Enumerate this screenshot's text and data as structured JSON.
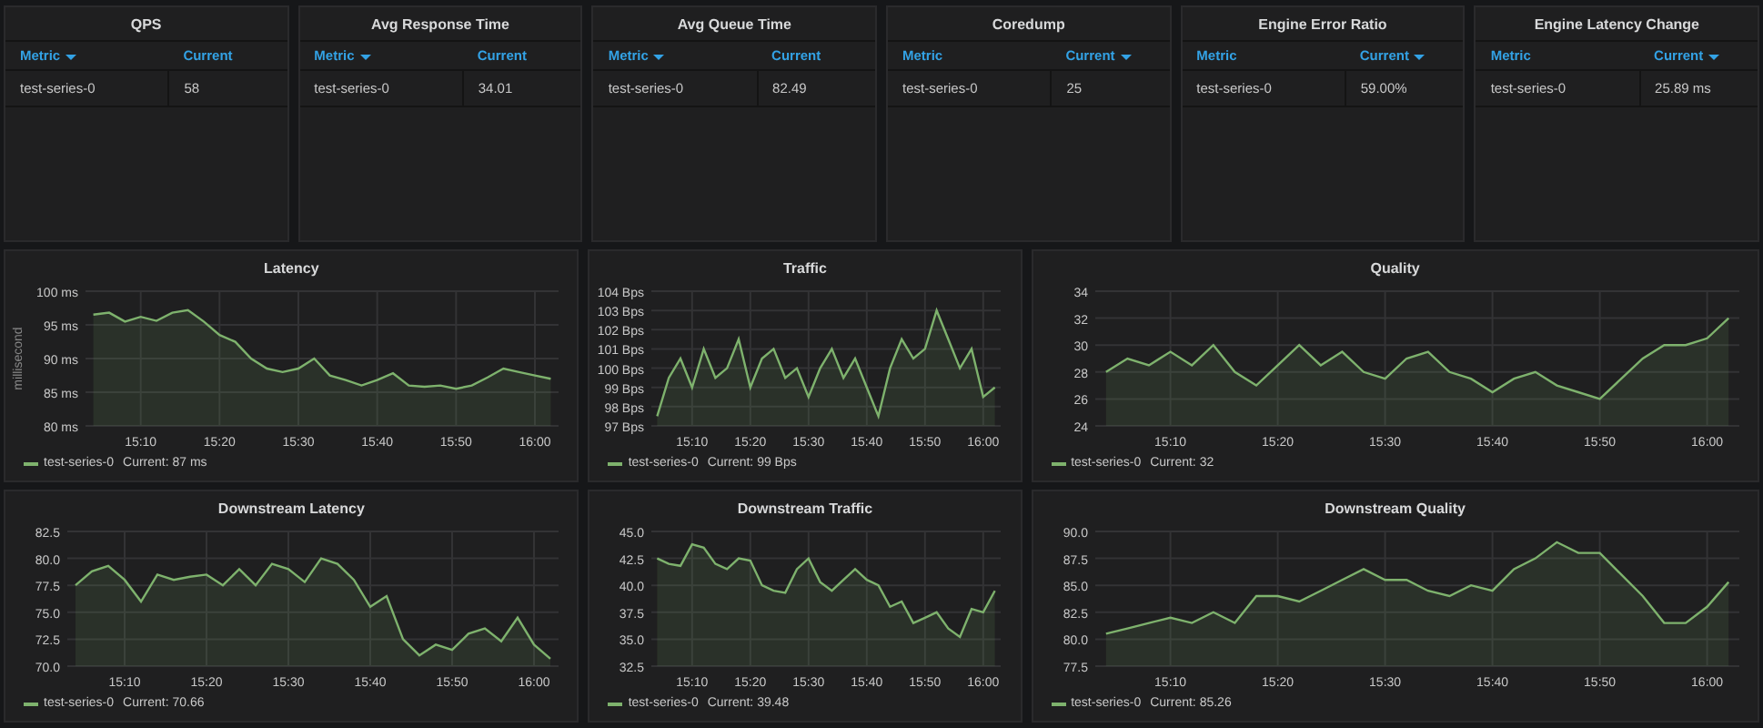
{
  "stat_panels": [
    {
      "title": "QPS",
      "columns": [
        {
          "label": "Metric",
          "sorted": true
        },
        {
          "label": "Current",
          "sorted": false
        }
      ],
      "rows": [
        [
          "test-series-0",
          "58"
        ]
      ]
    },
    {
      "title": "Avg Response Time",
      "columns": [
        {
          "label": "Metric",
          "sorted": true
        },
        {
          "label": "Current",
          "sorted": false
        }
      ],
      "rows": [
        [
          "test-series-0",
          "34.01"
        ]
      ]
    },
    {
      "title": "Avg Queue Time",
      "columns": [
        {
          "label": "Metric",
          "sorted": true
        },
        {
          "label": "Current",
          "sorted": false
        }
      ],
      "rows": [
        [
          "test-series-0",
          "82.49"
        ]
      ]
    },
    {
      "title": "Coredump",
      "columns": [
        {
          "label": "Metric",
          "sorted": false
        },
        {
          "label": "Current",
          "sorted": true
        }
      ],
      "rows": [
        [
          "test-series-0",
          "25"
        ]
      ]
    },
    {
      "title": "Engine Error Ratio",
      "columns": [
        {
          "label": "Metric",
          "sorted": false
        },
        {
          "label": "Current",
          "sorted": true
        }
      ],
      "rows": [
        [
          "test-series-0",
          "59.00%"
        ]
      ]
    },
    {
      "title": "Engine Latency Change",
      "columns": [
        {
          "label": "Metric",
          "sorted": false
        },
        {
          "label": "Current",
          "sorted": true
        }
      ],
      "rows": [
        [
          "test-series-0",
          "25.89 ms"
        ]
      ]
    }
  ],
  "graph_panels": [
    {
      "legend_value": "Current: 87 ms",
      "chart_data": {
        "type": "area",
        "grid": true,
        "title": "Latency",
        "ylabel": "millisecond",
        "categories": [
          null,
          null,
          null,
          "15:10",
          null,
          null,
          null,
          null,
          "15:20",
          null,
          null,
          null,
          null,
          "15:30",
          null,
          null,
          null,
          null,
          "15:40",
          null,
          null,
          null,
          null,
          "15:50",
          null,
          null,
          null,
          null,
          "16:00",
          null
        ],
        "series": [
          {
            "name": "test-series-0",
            "color": "#7eb26d",
            "values": [
              96.5,
              96.8,
              95.5,
              96.2,
              95.6,
              96.8,
              97.2,
              95.5,
              93.5,
              92.5,
              90,
              88.5,
              88,
              88.5,
              90,
              87.5,
              86.8,
              86,
              86.8,
              87.8,
              86,
              85.8,
              86,
              85.5,
              86,
              87.2,
              88.5,
              88,
              87.5,
              87
            ]
          }
        ],
        "ylim": [
          80,
          100
        ],
        "yticks": [
          {
            "value": 80,
            "label": "80 ms"
          },
          {
            "value": 85,
            "label": "85 ms"
          },
          {
            "value": 90,
            "label": "90 ms"
          },
          {
            "value": 95,
            "label": "95 ms"
          },
          {
            "value": 100,
            "label": "100 ms"
          }
        ]
      }
    },
    {
      "legend_value": "Current: 99 Bps",
      "chart_data": {
        "type": "area",
        "grid": true,
        "title": "Traffic",
        "categories": [
          null,
          null,
          null,
          "15:10",
          null,
          null,
          null,
          null,
          "15:20",
          null,
          null,
          null,
          null,
          "15:30",
          null,
          null,
          null,
          null,
          "15:40",
          null,
          null,
          null,
          null,
          "15:50",
          null,
          null,
          null,
          null,
          "16:00",
          null
        ],
        "series": [
          {
            "name": "test-series-0",
            "color": "#7eb26d",
            "values": [
              97.5,
              99.5,
              100.5,
              99,
              101,
              99.5,
              100,
              101.5,
              99,
              100.5,
              101,
              99.5,
              100,
              98.5,
              100,
              101,
              99.5,
              100.5,
              99,
              97.5,
              100,
              101.5,
              100.5,
              101,
              103,
              101.5,
              100,
              101,
              98.5,
              99
            ]
          }
        ],
        "ylim": [
          97,
          104
        ],
        "yticks": [
          {
            "value": 97,
            "label": "97 Bps"
          },
          {
            "value": 98,
            "label": "98 Bps"
          },
          {
            "value": 99,
            "label": "99 Bps"
          },
          {
            "value": 100,
            "label": "100 Bps"
          },
          {
            "value": 101,
            "label": "101 Bps"
          },
          {
            "value": 102,
            "label": "102 Bps"
          },
          {
            "value": 103,
            "label": "103 Bps"
          },
          {
            "value": 104,
            "label": "104 Bps"
          }
        ]
      }
    },
    {
      "legend_value": "Current: 32",
      "chart_data": {
        "type": "area",
        "grid": true,
        "title": "Quality",
        "categories": [
          null,
          null,
          null,
          "15:10",
          null,
          null,
          null,
          null,
          "15:20",
          null,
          null,
          null,
          null,
          "15:30",
          null,
          null,
          null,
          null,
          "15:40",
          null,
          null,
          null,
          null,
          "15:50",
          null,
          null,
          null,
          null,
          "16:00",
          null
        ],
        "series": [
          {
            "name": "test-series-0",
            "color": "#7eb26d",
            "values": [
              28,
              29,
              28.5,
              29.5,
              28.5,
              30,
              28,
              27,
              28.5,
              30,
              28.5,
              29.5,
              28,
              27.5,
              29,
              29.5,
              28,
              27.5,
              26.5,
              27.5,
              28,
              27,
              26.5,
              26,
              27.5,
              29,
              30,
              30,
              30.5,
              32
            ]
          }
        ],
        "ylim": [
          24,
          34
        ],
        "yticks": [
          24,
          26,
          28,
          30,
          32,
          34
        ]
      }
    },
    {
      "legend_value": "Current: 70.66",
      "chart_data": {
        "type": "area",
        "grid": true,
        "title": "Downstream Latency",
        "categories": [
          null,
          null,
          null,
          "15:10",
          null,
          null,
          null,
          null,
          "15:20",
          null,
          null,
          null,
          null,
          "15:30",
          null,
          null,
          null,
          null,
          "15:40",
          null,
          null,
          null,
          null,
          "15:50",
          null,
          null,
          null,
          null,
          "16:00",
          null
        ],
        "series": [
          {
            "name": "test-series-0",
            "color": "#7eb26d",
            "values": [
              77.5,
              78.8,
              79.3,
              78,
              76,
              78.5,
              78,
              78.3,
              78.5,
              77.5,
              79,
              77.5,
              79.5,
              79,
              77.8,
              80,
              79.5,
              78,
              75.5,
              76.5,
              72.5,
              71,
              72,
              71.5,
              73,
              73.5,
              72.3,
              74.5,
              72,
              70.7
            ]
          }
        ],
        "ylim": [
          70,
          82.5
        ],
        "yticks": [
          {
            "value": 70,
            "label": "70.0"
          },
          {
            "value": 72.5,
            "label": "72.5"
          },
          {
            "value": 75,
            "label": "75.0"
          },
          {
            "value": 77.5,
            "label": "77.5"
          },
          {
            "value": 80,
            "label": "80.0"
          },
          {
            "value": 82.5,
            "label": "82.5"
          }
        ]
      }
    },
    {
      "legend_value": "Current: 39.48",
      "chart_data": {
        "type": "area",
        "grid": true,
        "title": "Downstream Traffic",
        "categories": [
          null,
          null,
          null,
          "15:10",
          null,
          null,
          null,
          null,
          "15:20",
          null,
          null,
          null,
          null,
          "15:30",
          null,
          null,
          null,
          null,
          "15:40",
          null,
          null,
          null,
          null,
          "15:50",
          null,
          null,
          null,
          null,
          "16:00",
          null
        ],
        "series": [
          {
            "name": "test-series-0",
            "color": "#7eb26d",
            "values": [
              42.5,
              42,
              41.8,
              43.8,
              43.5,
              42,
              41.5,
              42.5,
              42.3,
              40,
              39.5,
              39.3,
              41.5,
              42.5,
              40.3,
              39.5,
              40.5,
              41.5,
              40.5,
              40,
              38,
              38.5,
              36.5,
              37,
              37.5,
              36,
              35.2,
              37.8,
              37.5,
              39.5
            ]
          }
        ],
        "ylim": [
          32.5,
          45
        ],
        "yticks": [
          {
            "value": 32.5,
            "label": "32.5"
          },
          {
            "value": 35,
            "label": "35.0"
          },
          {
            "value": 37.5,
            "label": "37.5"
          },
          {
            "value": 40,
            "label": "40.0"
          },
          {
            "value": 42.5,
            "label": "42.5"
          },
          {
            "value": 45,
            "label": "45.0"
          }
        ]
      }
    },
    {
      "legend_value": "Current: 85.26",
      "chart_data": {
        "type": "area",
        "grid": true,
        "title": "Downstream Quality",
        "categories": [
          null,
          null,
          null,
          "15:10",
          null,
          null,
          null,
          null,
          "15:20",
          null,
          null,
          null,
          null,
          "15:30",
          null,
          null,
          null,
          null,
          "15:40",
          null,
          null,
          null,
          null,
          "15:50",
          null,
          null,
          null,
          null,
          "16:00",
          null
        ],
        "series": [
          {
            "name": "test-series-0",
            "color": "#7eb26d",
            "values": [
              80.5,
              81,
              81.5,
              82,
              81.5,
              82.5,
              81.5,
              84,
              84,
              83.5,
              84.5,
              85.5,
              86.5,
              85.5,
              85.5,
              84.5,
              84,
              85,
              84.5,
              86.5,
              87.5,
              89,
              88,
              88,
              86,
              84,
              81.5,
              81.5,
              83,
              85.3
            ]
          }
        ],
        "ylim": [
          77.5,
          90
        ],
        "yticks": [
          {
            "value": 77.5,
            "label": "77.5"
          },
          {
            "value": 80,
            "label": "80.0"
          },
          {
            "value": 82.5,
            "label": "82.5"
          },
          {
            "value": 85,
            "label": "85.0"
          },
          {
            "value": 87.5,
            "label": "87.5"
          },
          {
            "value": 90,
            "label": "90.0"
          }
        ]
      }
    }
  ]
}
